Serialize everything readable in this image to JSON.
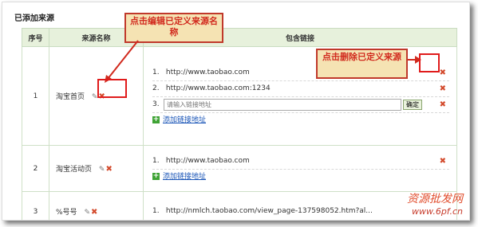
{
  "section_title": "已添加来源",
  "table": {
    "headers": [
      "序号",
      "来源名称",
      "包含链接"
    ],
    "rows": [
      {
        "index": "1",
        "name": "淘宝首页",
        "links": [
          {
            "idx": "1.",
            "url": "http://www.taobao.com"
          },
          {
            "idx": "2.",
            "url": "http://www.taobao.com:1234"
          }
        ],
        "input_idx": "3.",
        "input_placeholder": "请输入链接地址",
        "confirm_label": "确定",
        "add_link_label": "添加链接地址"
      },
      {
        "index": "2",
        "name": "淘宝活动页",
        "links": [
          {
            "idx": "1.",
            "url": "http://www.taobao.com"
          }
        ],
        "add_link_label": "添加链接地址"
      },
      {
        "index": "3",
        "name": "%号号",
        "links": [
          {
            "idx": "1.",
            "url": "http://nmlch.taobao.com/view_page-137598052.htm?al..."
          }
        ]
      }
    ]
  },
  "icons": {
    "edit": "pencil-icon",
    "delete": "x-icon",
    "add": "plus-icon"
  },
  "callouts": {
    "edit": "点击编辑已定义来源名称",
    "delete": "点击删除已定义来源"
  },
  "watermark": {
    "line1": "资源批发网",
    "line2": "www.6pf.cn"
  },
  "colors": {
    "header_bg": "#e7f1dc",
    "delete_red": "#d34a2c",
    "callout_bg": "#f5e3b3",
    "callout_border": "#c0392b",
    "link_blue": "#1a55b7"
  }
}
